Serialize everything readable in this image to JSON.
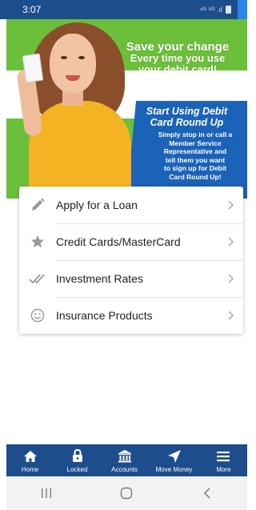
{
  "status_bar": {
    "time": "3:07",
    "icons_text": "⁴ᴳ ⁵ᴳ .ıl"
  },
  "hero": {
    "headline_line1": "Save your change",
    "headline_line2": "Every time you use",
    "headline_line3": "your debit card!",
    "sub_headline_line1": "Start Using Debit",
    "sub_headline_line2": "Card Round Up",
    "body_lines": [
      "Simply stop in or call a",
      "Member Service",
      "Representative and",
      "tell them you want",
      "to sign up for Debit",
      "Card Round Up!"
    ]
  },
  "menu": {
    "items": [
      {
        "label": "Apply for a Loan",
        "icon": "pencil-icon"
      },
      {
        "label": "Credit Cards/MasterCard",
        "icon": "star-icon"
      },
      {
        "label": "Investment Rates",
        "icon": "double-check-icon"
      },
      {
        "label": "Insurance Products",
        "icon": "smiley-icon"
      }
    ]
  },
  "tabs": [
    {
      "label": "Home",
      "icon": "home-icon"
    },
    {
      "label": "Locked",
      "icon": "lock-icon"
    },
    {
      "label": "Accounts",
      "icon": "bank-icon"
    },
    {
      "label": "Move Money",
      "icon": "send-icon"
    },
    {
      "label": "More",
      "icon": "menu-icon"
    }
  ],
  "colors": {
    "brand_blue": "#1d4d8c",
    "hero_green": "#6cbf3a",
    "hero_blue": "#1b63b8"
  }
}
